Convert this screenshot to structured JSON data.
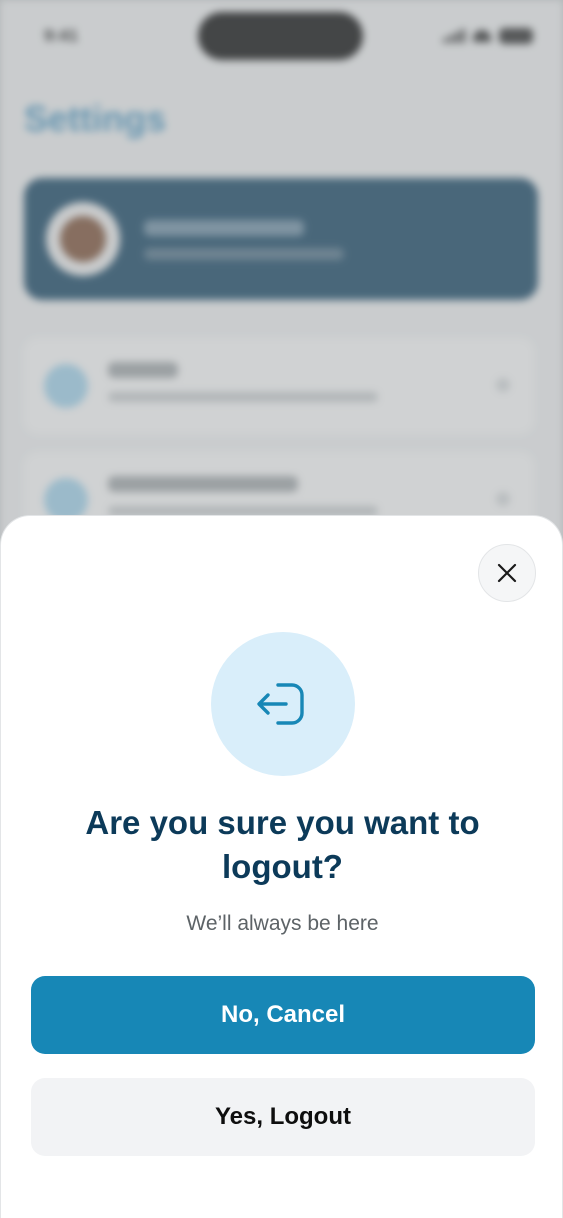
{
  "background": {
    "status_time": "9:41",
    "title": "Settings"
  },
  "logout_sheet": {
    "title": "Are you sure you want to logout?",
    "subtitle": "We’ll always be here",
    "cancel_label": "No, Cancel",
    "logout_label": "Yes, Logout",
    "icon": "logout-icon",
    "close_icon": "close-icon"
  },
  "colors": {
    "primary": "#1787b6",
    "title": "#0c3a59",
    "icon_bg": "#d9eefa"
  }
}
